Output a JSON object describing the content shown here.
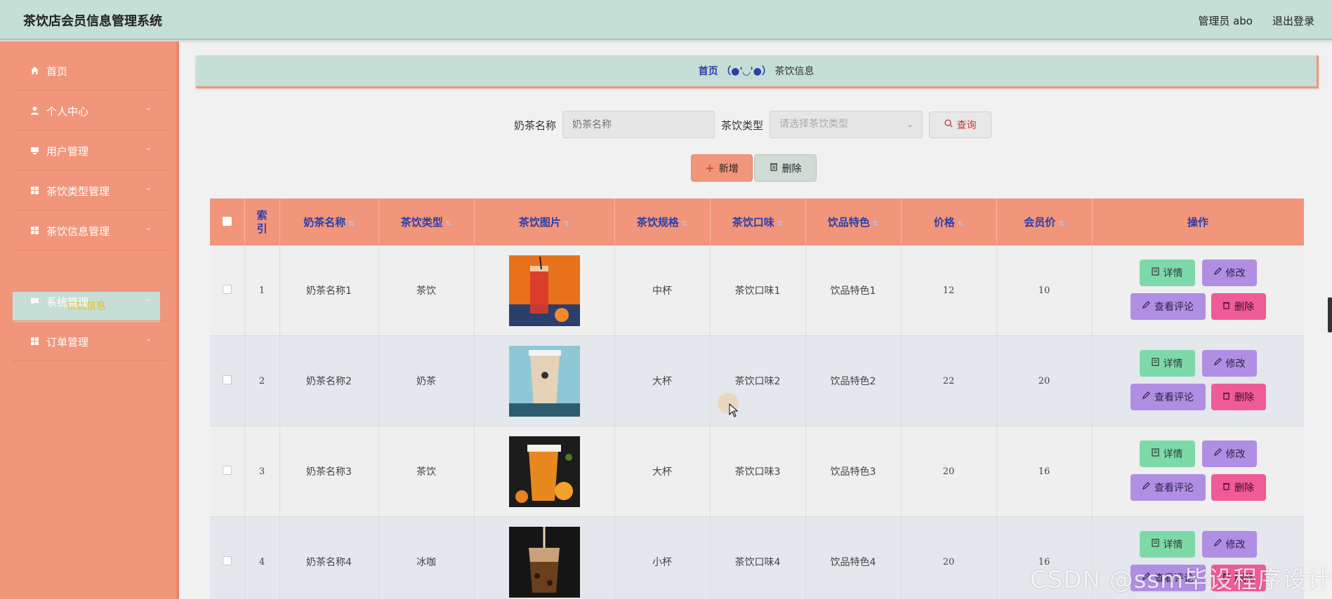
{
  "header": {
    "app_title": "茶饮店会员信息管理系统",
    "admin_label": "管理员 abo",
    "logout_label": "退出登录"
  },
  "sidebar": {
    "items": [
      {
        "label": "首页",
        "icon": "home-icon",
        "has_children": false
      },
      {
        "label": "个人中心",
        "icon": "user-icon",
        "has_children": true
      },
      {
        "label": "用户管理",
        "icon": "monitor-icon",
        "has_children": true
      },
      {
        "label": "茶饮类型管理",
        "icon": "grid-icon",
        "has_children": true
      },
      {
        "label": "茶饮信息管理",
        "icon": "grid-icon",
        "has_children": true
      },
      {
        "label": "系统管理",
        "icon": "chat-icon",
        "has_children": true
      },
      {
        "label": "订单管理",
        "icon": "grid-icon",
        "has_children": true
      }
    ],
    "active_submenu": "茶饮信息"
  },
  "breadcrumb": {
    "home": "首页",
    "separator": "（●'◡'●）",
    "current": "茶饮信息"
  },
  "search": {
    "name_label": "奶茶名称",
    "name_placeholder": "奶茶名称",
    "type_label": "茶饮类型",
    "type_placeholder": "请选择茶饮类型",
    "query_button": "查询"
  },
  "actions": {
    "add_button": "新增",
    "delete_button": "删除"
  },
  "table": {
    "columns": [
      "索引",
      "奶茶名称",
      "茶饮类型",
      "茶饮图片",
      "茶饮规格",
      "茶饮口味",
      "饮品特色",
      "价格",
      "会员价",
      "操作"
    ],
    "rows": [
      {
        "index": "1",
        "name": "奶茶名称1",
        "type": "茶饮",
        "image": "red-fruit-tea-image",
        "spec": "中杯",
        "flavor": "茶饮口味1",
        "feature": "饮品特色1",
        "price": "12",
        "member_price": "10"
      },
      {
        "index": "2",
        "name": "奶茶名称2",
        "type": "奶茶",
        "image": "milk-tea-cup-image",
        "spec": "大杯",
        "flavor": "茶饮口味2",
        "feature": "饮品特色2",
        "price": "22",
        "member_price": "20"
      },
      {
        "index": "3",
        "name": "奶茶名称3",
        "type": "茶饮",
        "image": "orange-tea-image",
        "spec": "大杯",
        "flavor": "茶饮口味3",
        "feature": "饮品特色3",
        "price": "20",
        "member_price": "16"
      },
      {
        "index": "4",
        "name": "奶茶名称4",
        "type": "冰咖",
        "image": "iced-coffee-image",
        "spec": "小杯",
        "flavor": "茶饮口味4",
        "feature": "饮品特色4",
        "price": "20",
        "member_price": "16"
      }
    ],
    "row_actions": {
      "detail": "详情",
      "edit": "修改",
      "review": "查看评论",
      "delete": "删除"
    }
  },
  "watermark": "CSDN @ssm毕设程序设计",
  "colors": {
    "header_bg": "#c5ded6",
    "sidebar_bg": "#f1957b",
    "header_text_blue": "#2b3fa8",
    "detail_green": "#7ed9a9",
    "edit_purple": "#b08ee3",
    "delete_pink": "#ef5b97"
  }
}
